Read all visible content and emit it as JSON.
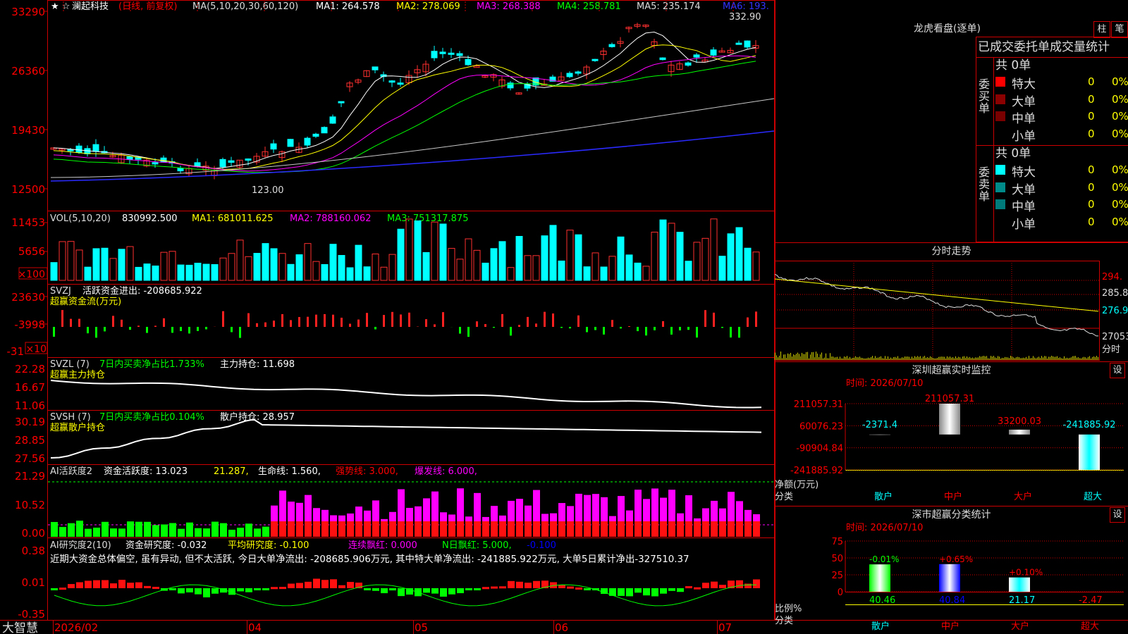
{
  "left_axis": {
    "price": [
      "33290",
      "26360",
      "19430",
      "12500"
    ],
    "volume": [
      "11453",
      "5656"
    ],
    "volume_unit": "×100",
    "svzj": [
      "23630",
      "-3998",
      "-31"
    ],
    "svzj_unit": "×10",
    "svzl": [
      "22.28",
      "16.67",
      "11.06"
    ],
    "svsh": [
      "30.19",
      "28.85",
      "27.56"
    ],
    "activity": [
      "21.29",
      "10.52",
      "0.00"
    ],
    "research": [
      "0.38",
      "0.01",
      "-0.35"
    ]
  },
  "bottom": {
    "brand": "大智慧",
    "dates": [
      "2026/02",
      "04",
      "05",
      "06",
      "07"
    ]
  },
  "price_panel": {
    "stock": "澜起科技",
    "adj": "(日线, 前复权)",
    "ma_title": "MA(5,10,20,30,60,120)",
    "ma1": "MA1: 264.578",
    "ma2": "MA2: 278.069",
    "ma3": "MA3: 268.388",
    "ma4": "MA4: 258.781",
    "ma5": "MA5: 235.174",
    "ma6": "MA6: 193.",
    "high_label": "332.90",
    "low_label": "123.00"
  },
  "vol_panel": {
    "title": "VOL(5,10,20)",
    "value": "830992.500",
    "ma1": "MA1: 681011.625",
    "ma2": "MA2: 788160.062",
    "ma3": "MA3: 751317.875"
  },
  "svzj_panel": {
    "title": "SVZJ",
    "label": "活跃资金进出: -208685.922",
    "sub": "超赢资金流(万元)"
  },
  "svzl_panel": {
    "title": "SVZL (7)",
    "label": "7日内买卖净占比1.733%",
    "hold": "主力持仓: 11.698",
    "sub": "超赢主力持仓"
  },
  "svsh_panel": {
    "title": "SVSH (7)",
    "label": "7日内买卖净占比0.104%",
    "hold": "散户持仓: 28.957",
    "sub": "超赢散户持仓"
  },
  "act_panel": {
    "title": "AI活跃度2",
    "a": "资金活跃度: 13.023",
    "b": "21.287,",
    "c": "生命线: 1.560,",
    "d": "强势线: 3.000,",
    "e": "爆发线: 6.000,"
  },
  "res_panel": {
    "title": "AI研究度2(10)",
    "a": "资金研究度: -0.032",
    "b": "平均研究度: -0.100",
    "c": "连续飘红: 0.000",
    "d": "N日飘红: 5.000,",
    "e": "-0.100",
    "comment": "近期大资金总体偏空, 虽有异动, 但不太活跃, 今日大单净流出: -208685.906万元, 其中特大单净流出: -241885.922万元, 大单5日累计净出-327510.37"
  },
  "right": {
    "lhkp_title": "龙虎看盘(逐单)",
    "btn_zhu": "柱",
    "btn_bi": "笔",
    "table_header": "已成交委托单成交量统计",
    "buy_label": [
      "委",
      "买",
      "单"
    ],
    "sell_label": [
      "委",
      "卖",
      "单"
    ],
    "buy_total": "共 0单",
    "sell_total": "共 0单",
    "levels": [
      "特大",
      "大单",
      "中单",
      "小单"
    ],
    "buy_rows": [
      {
        "count": "0",
        "pct": "0%"
      },
      {
        "count": "0",
        "pct": "0%"
      },
      {
        "count": "0",
        "pct": "0%"
      },
      {
        "count": "0",
        "pct": "0%"
      }
    ],
    "sell_rows": [
      {
        "count": "0",
        "pct": "0%"
      },
      {
        "count": "0",
        "pct": "0%"
      },
      {
        "count": "0",
        "pct": "0%"
      },
      {
        "count": "0",
        "pct": "0%"
      }
    ],
    "buy_colors": [
      "#ff0000",
      "#8b0000",
      "#7a0000",
      ""
    ],
    "sell_colors": [
      "#00ffff",
      "#008b8b",
      "#007b7b",
      ""
    ],
    "intraday_title": "分时走势",
    "intraday_prices": [
      "294.",
      "285.8",
      "276.9",
      "27053"
    ],
    "intraday_unit": "分时",
    "sz_title": "深圳超赢实时监控",
    "gear": "设",
    "sz_time": "时间: 2026/07/10",
    "sz_axis": [
      "211057.31",
      "60076.23",
      "-90904.84",
      "-241885.92"
    ],
    "sz_axis_name": "净额(万元)",
    "sz_cat_label": "分类",
    "sz_categories": [
      "散户",
      "中户",
      "大户",
      "超大"
    ],
    "sz_value_labels": [
      "-2371.4",
      "211057.31",
      "33200.03",
      "-241885.92"
    ],
    "cls_title": "深市超赢分类统计",
    "cls_time": "时间: 2026/07/10",
    "cls_axis": [
      "75",
      "50",
      "25",
      "0"
    ],
    "cls_axis_name": "比例%",
    "cls_cat_label": "分类",
    "cls_top_labels": [
      "-0.01%",
      "+0.65%",
      "+0.10%"
    ],
    "cls_bottom_labels": [
      "40.46",
      "40.84",
      "21.17",
      "-2.47"
    ],
    "cls_categories": [
      "散户",
      "中户",
      "大户",
      "超大"
    ]
  },
  "chart_data": [
    {
      "type": "bar",
      "title": "深圳超赢实时监控",
      "ylabel": "净额(万元)",
      "categories": [
        "散户",
        "中户",
        "大户",
        "超大"
      ],
      "values": [
        -2371.4,
        211057.31,
        33200.03,
        -241885.92
      ],
      "ylim": [
        -241885.92,
        211057.31
      ]
    },
    {
      "type": "bar",
      "title": "深市超赢分类统计",
      "ylabel": "比例%",
      "categories": [
        "散户",
        "中户",
        "大户",
        "超大"
      ],
      "values": [
        40.46,
        40.84,
        21.17,
        -2.47
      ],
      "ylim": [
        0,
        75
      ]
    }
  ]
}
